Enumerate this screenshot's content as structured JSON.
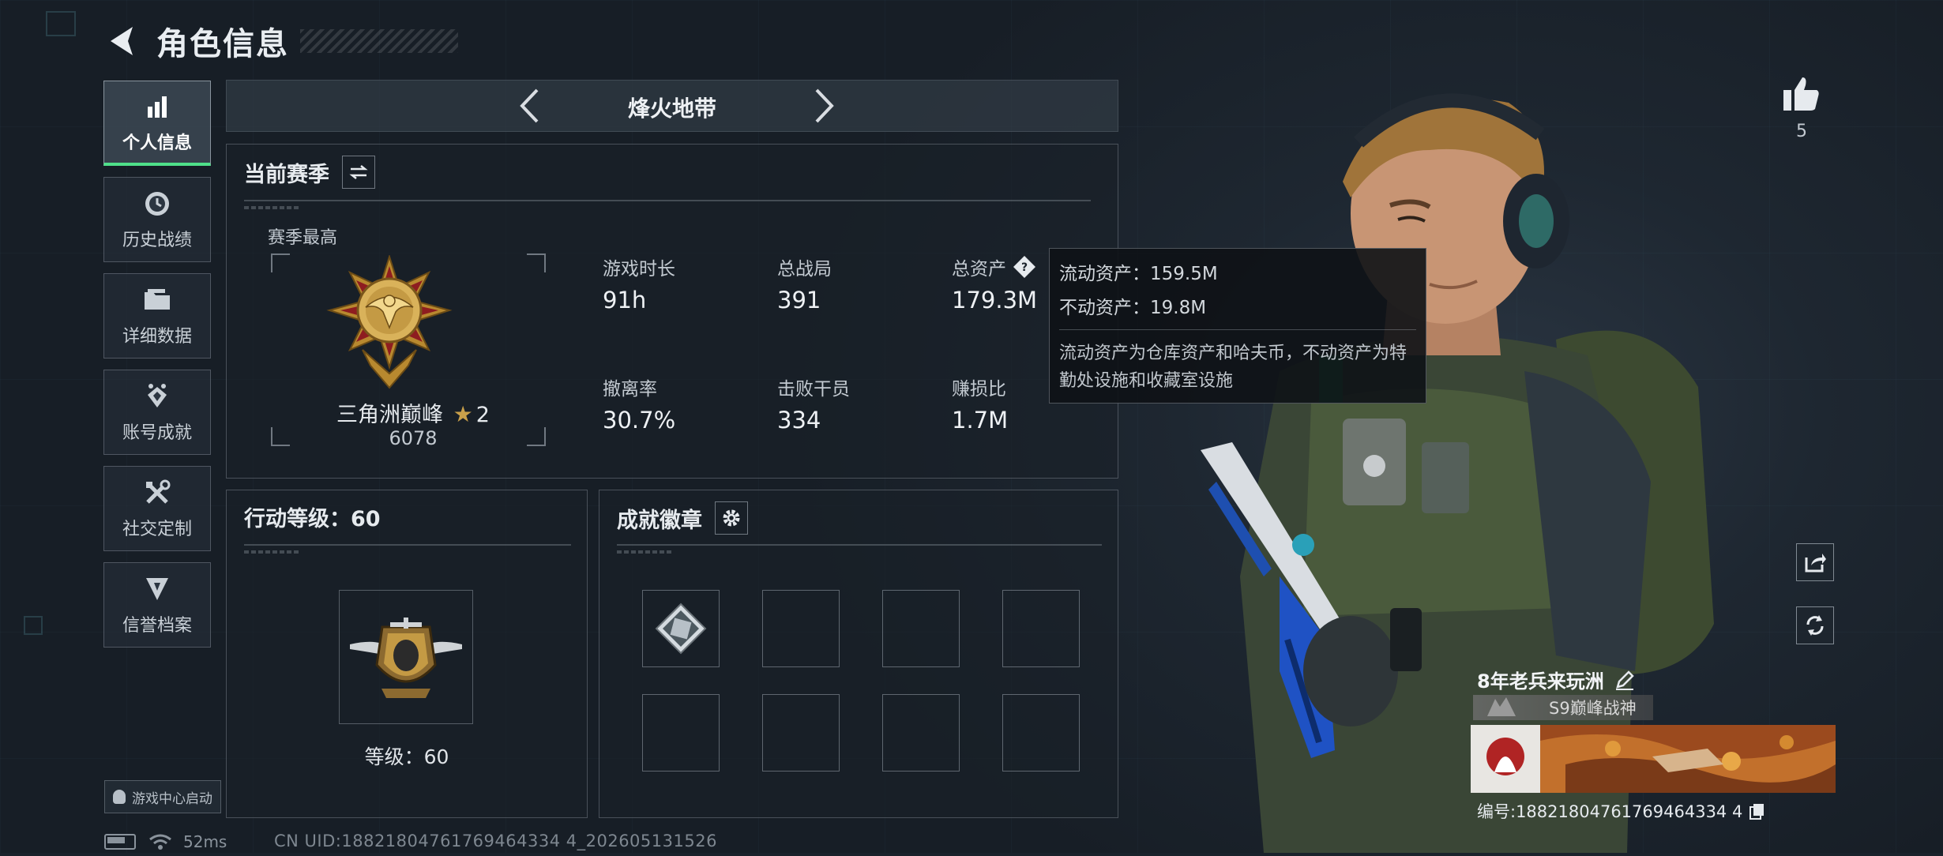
{
  "header": {
    "title": "角色信息"
  },
  "nav": {
    "items": [
      {
        "label": "个人信息",
        "icon": "bar-chart-icon",
        "active": true
      },
      {
        "label": "历史战绩",
        "icon": "history-icon",
        "active": false
      },
      {
        "label": "详细数据",
        "icon": "folder-icon",
        "active": false
      },
      {
        "label": "账号成就",
        "icon": "achievement-icon",
        "active": false
      },
      {
        "label": "社交定制",
        "icon": "tools-icon",
        "active": false
      },
      {
        "label": "信誉档案",
        "icon": "credit-icon",
        "active": false
      }
    ],
    "launch_label": "游戏中心启动"
  },
  "status": {
    "ping": "52ms",
    "uid": "CN UID:18821804761769464334 4_202605131526"
  },
  "mode": {
    "title": "烽火地带"
  },
  "season": {
    "title": "当前赛季",
    "subtitle": "赛季最高",
    "rank_name": "三角洲巅峰",
    "rank_stars": "2",
    "rank_score": "6078",
    "stats": [
      {
        "label": "游戏时长",
        "value": "91h"
      },
      {
        "label": "总战局",
        "value": "391"
      },
      {
        "label": "总资产",
        "value": "179.3M"
      },
      {
        "label": "撤离率",
        "value": "30.7%"
      },
      {
        "label": "击败干员",
        "value": "334"
      },
      {
        "label": "赚损比",
        "value": "1.7M"
      }
    ]
  },
  "tooltip": {
    "liquid": "流动资产：159.5M",
    "fixed": "不动资产：19.8M",
    "desc": "流动资产为仓库资产和哈夫币，不动资产为特勤处设施和收藏室设施"
  },
  "level": {
    "title": "行动等级：60",
    "label": "等级：60"
  },
  "badges": {
    "title": "成就徽章"
  },
  "profile": {
    "likes": "5",
    "name": "8年老兵来玩洲",
    "title_tag": "S9巅峰战神",
    "id": "编号:18821804761769464334 4"
  },
  "colors": {
    "accent_green": "#4fe08a",
    "gold": "#c9a04a"
  }
}
